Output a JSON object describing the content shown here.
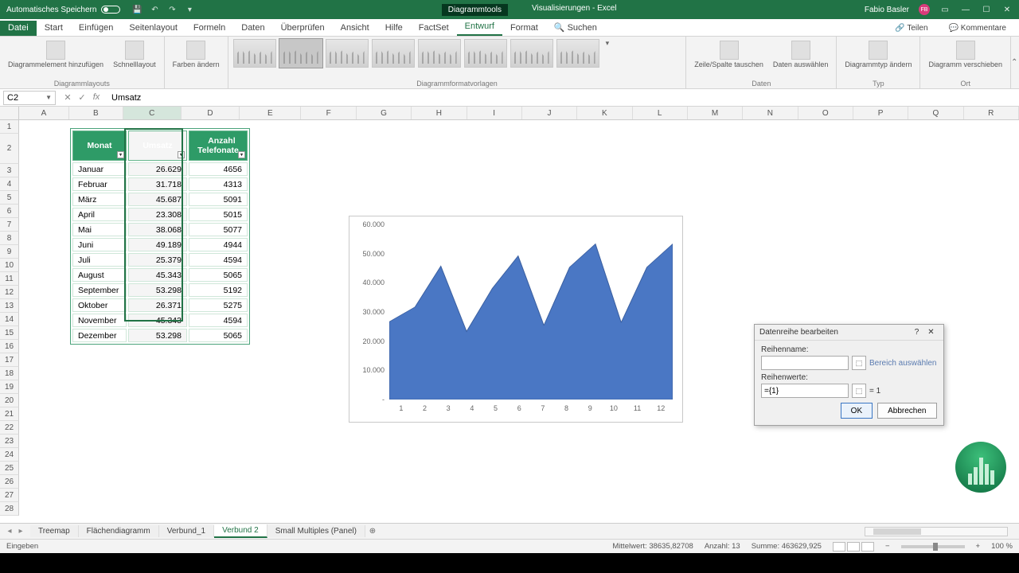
{
  "titlebar": {
    "autosave": "Automatisches Speichern",
    "context_tool": "Diagrammtools",
    "doc_context": "Visualisierungen",
    "app": "Excel",
    "user": "Fabio Basler",
    "user_initials": "FB"
  },
  "menu": {
    "file": "Datei",
    "tabs": [
      "Start",
      "Einfügen",
      "Seitenlayout",
      "Formeln",
      "Daten",
      "Überprüfen",
      "Ansicht",
      "Hilfe",
      "FactSet",
      "Entwurf",
      "Format"
    ],
    "active": "Entwurf",
    "tell_me": "Suchen",
    "share": "Teilen",
    "comments": "Kommentare"
  },
  "ribbon": {
    "g_layouts": "Diagrammlayouts",
    "btn_add_elem": "Diagrammelement hinzufügen",
    "btn_quick": "Schnelllayout",
    "btn_colors": "Farben ändern",
    "g_styles": "Diagrammformatvorlagen",
    "g_data": "Daten",
    "btn_switch": "Zeile/Spalte tauschen",
    "btn_select": "Daten auswählen",
    "g_type": "Typ",
    "btn_change": "Diagrammtyp ändern",
    "g_loc": "Ort",
    "btn_move": "Diagramm verschieben"
  },
  "formula_bar": {
    "cell_ref": "C2",
    "value": "Umsatz"
  },
  "columns": [
    "A",
    "B",
    "C",
    "D",
    "E",
    "F",
    "G",
    "H",
    "I",
    "J",
    "K",
    "L",
    "M",
    "N",
    "O",
    "P",
    "Q",
    "R"
  ],
  "table": {
    "headers": [
      "Monat",
      "Umsatz",
      "Anzahl Telefonate"
    ],
    "rows": [
      [
        "Januar",
        "26.629",
        "4656"
      ],
      [
        "Februar",
        "31.718",
        "4313"
      ],
      [
        "März",
        "45.687",
        "5091"
      ],
      [
        "April",
        "23.308",
        "5015"
      ],
      [
        "Mai",
        "38.068",
        "5077"
      ],
      [
        "Juni",
        "49.189",
        "4944"
      ],
      [
        "Juli",
        "25.379",
        "4594"
      ],
      [
        "August",
        "45.343",
        "5065"
      ],
      [
        "September",
        "53.298",
        "5192"
      ],
      [
        "Oktober",
        "26.371",
        "5275"
      ],
      [
        "November",
        "45.343",
        "4594"
      ],
      [
        "Dezember",
        "53.298",
        "5065"
      ]
    ]
  },
  "chart_data": {
    "type": "area",
    "categories": [
      "1",
      "2",
      "3",
      "4",
      "5",
      "6",
      "7",
      "8",
      "9",
      "10",
      "11",
      "12"
    ],
    "values": [
      26629,
      31718,
      45687,
      23308,
      38068,
      49189,
      25379,
      45343,
      53298,
      26371,
      45343,
      53298
    ],
    "ylim": [
      0,
      60000
    ],
    "y_ticks": [
      "60.000",
      "50.000",
      "40.000",
      "30.000",
      "20.000",
      "10.000",
      "-"
    ],
    "title": "",
    "xlabel": "",
    "ylabel": ""
  },
  "dialog": {
    "title": "Datenreihe bearbeiten",
    "lbl_name": "Reihenname:",
    "select_range": "Bereich auswählen",
    "lbl_values": "Reihenwerte:",
    "values_val": "={1}",
    "values_preview": "= 1",
    "ok": "OK",
    "cancel": "Abbrechen"
  },
  "sheets": [
    "Treemap",
    "Flächendiagramm",
    "Verbund_1",
    "Verbund 2",
    "Small Multiples (Panel)"
  ],
  "active_sheet": "Verbund 2",
  "status": {
    "mode": "Eingeben",
    "avg_lbl": "Mittelwert:",
    "avg": "38635,82708",
    "count_lbl": "Anzahl:",
    "count": "13",
    "sum_lbl": "Summe:",
    "sum": "463629,925",
    "zoom": "100 %"
  }
}
